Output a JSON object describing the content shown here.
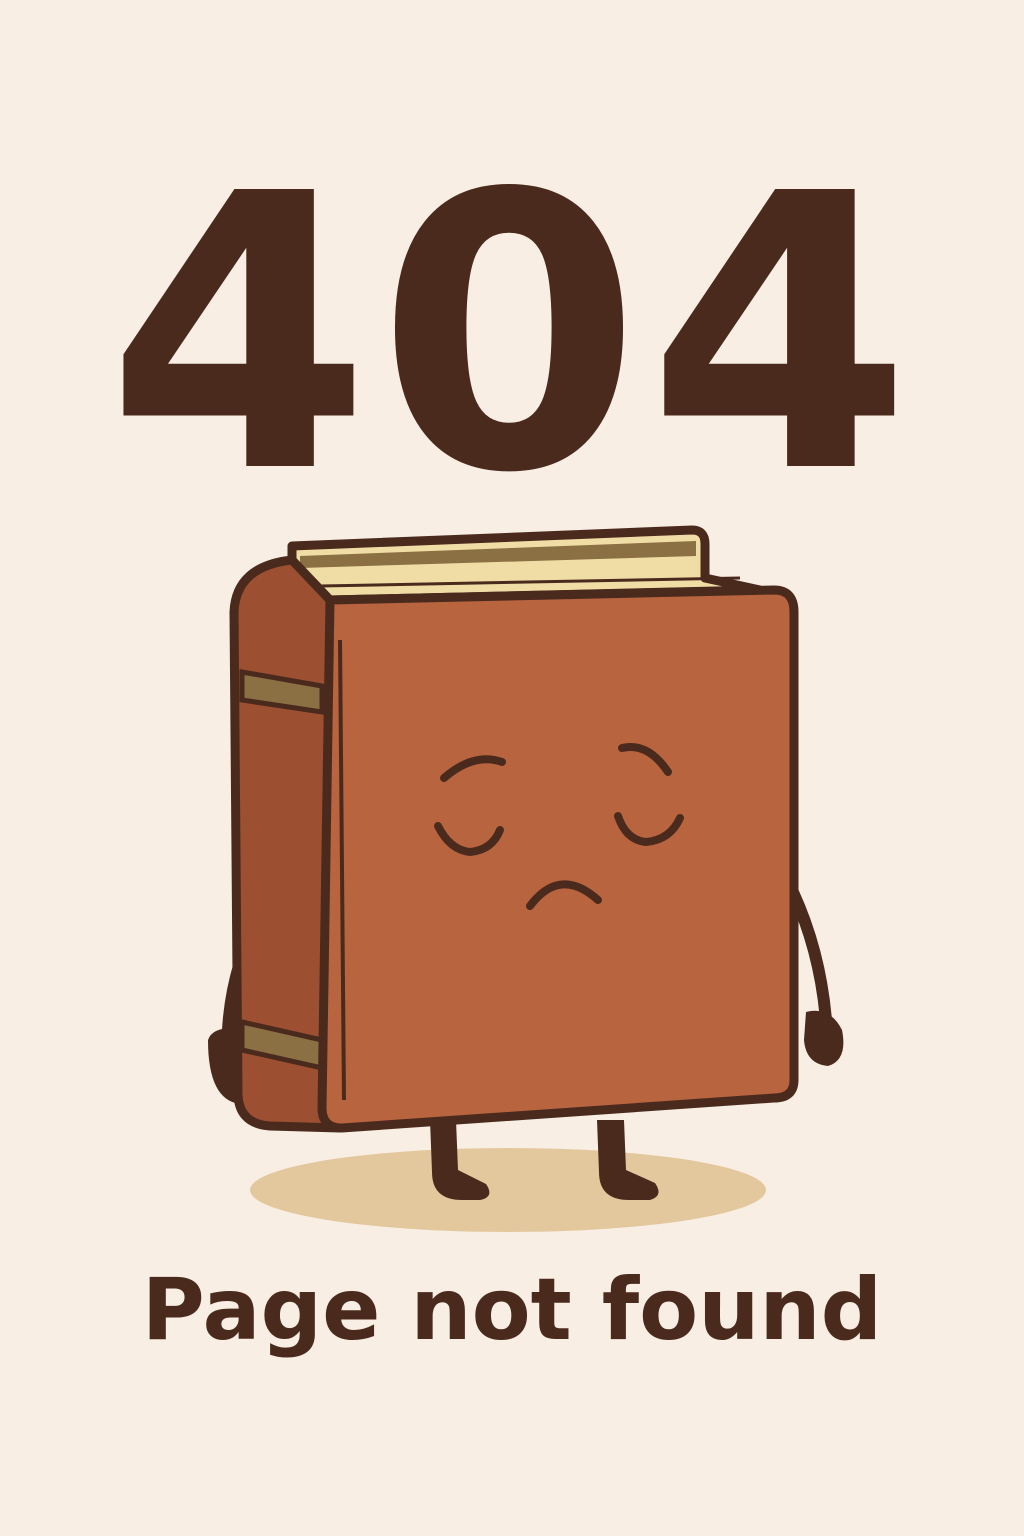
{
  "error": {
    "code": "404",
    "message": "Page not found"
  },
  "illustration": {
    "subject": "sad-book-character",
    "colors": {
      "background": "#f8eee3",
      "outline": "#4b2a1e",
      "cover": "#b8643f",
      "spine": "#9c4f31",
      "band": "#8a7042",
      "pages": "#f0dda6",
      "shadow": "#e3c89d"
    }
  }
}
